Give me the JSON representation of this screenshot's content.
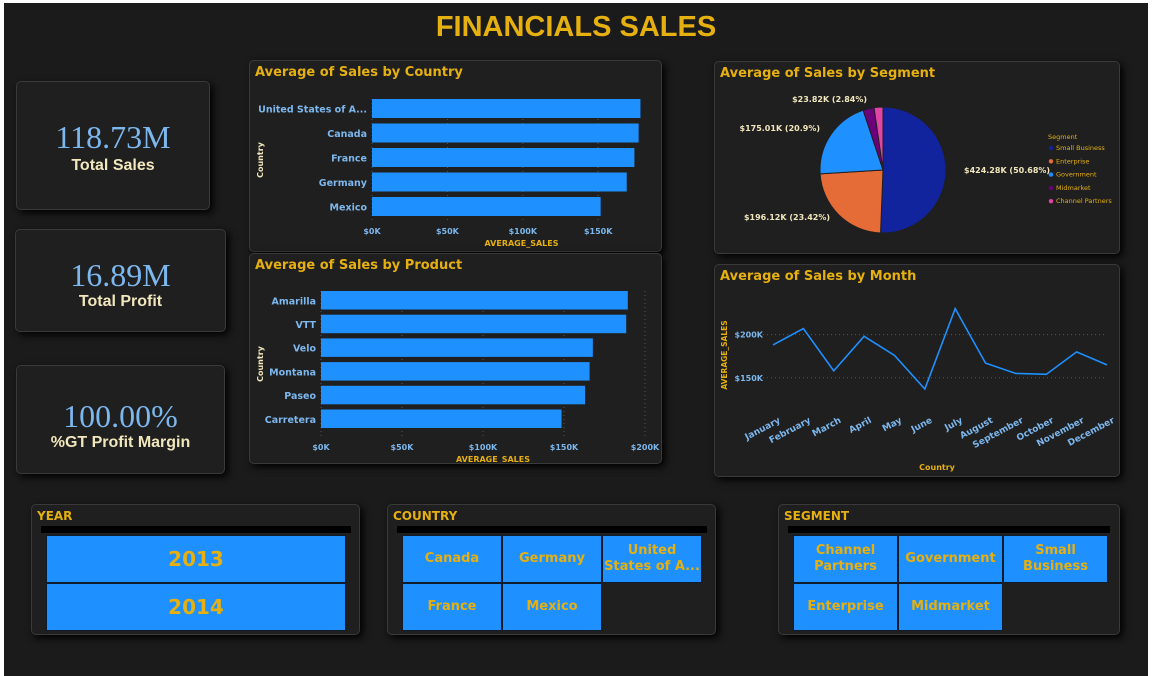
{
  "title": "FINANCIALS SALES",
  "kpis": {
    "total_sales": {
      "value": "118.73M",
      "label": "Total Sales"
    },
    "total_profit": {
      "value": "16.89M",
      "label": "Total Profit"
    },
    "margin": {
      "value": "100.00%",
      "label": "%GT Profit Margin"
    }
  },
  "country_chart": {
    "title": "Average of Sales by Country",
    "ylabel": "Country",
    "xlabel": "AVERAGE_SALES",
    "ticks": [
      "$0K",
      "$50K",
      "$100K",
      "$150K"
    ],
    "tick_values": [
      0,
      50,
      100,
      150
    ],
    "chart_data": {
      "type": "bar",
      "orientation": "horizontal",
      "categories": [
        "United States of A...",
        "Canada",
        "France",
        "Germany",
        "Mexico"
      ],
      "values": [
        178.0,
        176.8,
        174.0,
        168.9,
        151.6
      ],
      "xlabel": "AVERAGE_SALES",
      "ylabel": "Country",
      "xlim": [
        0,
        185
      ],
      "color": "#1e90ff"
    }
  },
  "product_chart": {
    "title": "Average of Sales by Product",
    "ylabel": "Country",
    "xlabel": "AVERAGE_SALES",
    "ticks": [
      "$0K",
      "$50K",
      "$100K",
      "$150K",
      "$200K"
    ],
    "tick_values": [
      0,
      50,
      100,
      150,
      200
    ],
    "chart_data": {
      "type": "bar",
      "orientation": "horizontal",
      "categories": [
        "Amarilla",
        "VTT",
        "Velo",
        "Montana",
        "Paseo",
        "Carretera"
      ],
      "values": [
        189.4,
        188.4,
        167.8,
        165.8,
        163.0,
        148.5
      ],
      "xlabel": "AVERAGE_SALES",
      "ylabel": "Country",
      "xlim": [
        0,
        200
      ],
      "color": "#1e90ff"
    }
  },
  "segment_chart": {
    "title": "Average of Sales by Segment",
    "legend_title": "Segment",
    "chart_data": {
      "type": "pie",
      "labels": [
        "Small Business",
        "Enterprise",
        "Government",
        "Midmarket",
        "Channel Partners"
      ],
      "values": [
        424.28,
        196.12,
        175.01,
        23.82,
        19.0
      ],
      "data_labels": [
        "$424.28K (50.68%)",
        "$196.12K (23.42%)",
        "$175.01K (20.9%)",
        "$23.82K (2.84%)",
        ""
      ],
      "colors": [
        "#12239e",
        "#e66c37",
        "#1e90ff",
        "#6b007b",
        "#e044a7"
      ],
      "legend_position": "right"
    }
  },
  "month_chart": {
    "title": "Average of Sales by Month",
    "ylabel": "AVERAGE_SALES",
    "xlabel": "Country",
    "yticks": [
      "$150K",
      "$200K"
    ],
    "ytick_values": [
      150,
      200
    ],
    "chart_data": {
      "type": "line",
      "x": [
        "January",
        "February",
        "March",
        "April",
        "May",
        "June",
        "July",
        "August",
        "September",
        "October",
        "November",
        "December"
      ],
      "y": [
        188,
        207,
        158,
        198,
        176,
        137,
        230,
        167,
        155,
        154,
        180,
        165
      ],
      "ylim": [
        122,
        240
      ],
      "xlabel": "Country",
      "ylabel": "AVERAGE_SALES",
      "color": "#1e90ff"
    }
  },
  "slicers": {
    "year": {
      "title": "YEAR",
      "items": [
        "2013",
        "2014"
      ]
    },
    "country": {
      "title": "COUNTRY",
      "items": [
        "Canada",
        "Germany",
        "United States of A...",
        "France",
        "Mexico"
      ]
    },
    "segment": {
      "title": "SEGMENT",
      "items": [
        "Channel Partners",
        "Government",
        "Small Business",
        "Enterprise",
        "Midmarket"
      ]
    }
  }
}
